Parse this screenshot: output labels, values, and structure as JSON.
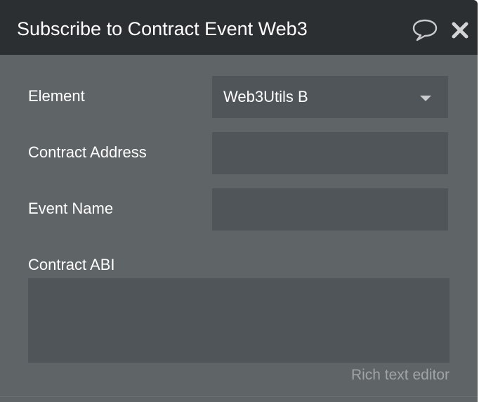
{
  "header": {
    "title": "Subscribe to Contract Event Web3",
    "comment_icon": "speech-bubble-icon",
    "close_icon": "close-x-icon"
  },
  "fields": {
    "element": {
      "label": "Element",
      "value": "Web3Utils B"
    },
    "contract_address": {
      "label": "Contract Address",
      "value": ""
    },
    "event_name": {
      "label": "Event Name",
      "value": ""
    },
    "contract_abi": {
      "label": "Contract ABI",
      "hint": "Rich text editor"
    }
  },
  "colors": {
    "header_bg": "#2b2f32",
    "panel_bg": "#5f6467",
    "field_bg": "#50555a"
  }
}
